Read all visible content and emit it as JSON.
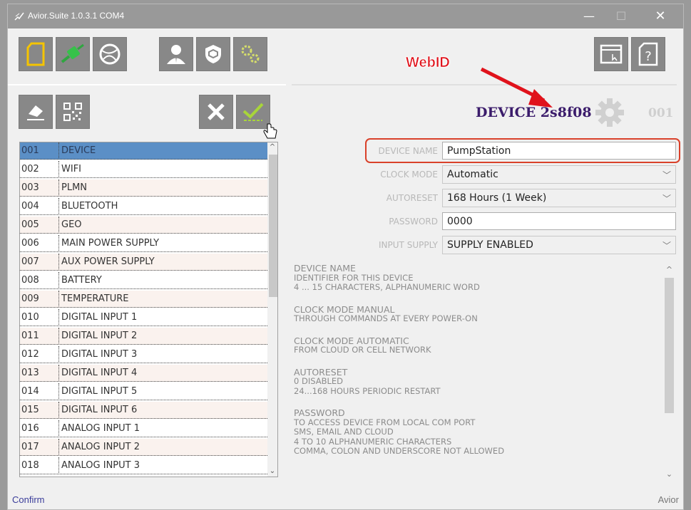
{
  "window": {
    "title": "Avior.Suite 1.0.3.1  COM4",
    "minimize": "—",
    "maximize": "☐",
    "close": "✕"
  },
  "toolbar": {
    "icons": [
      "new-document-icon",
      "usb-connection-icon",
      "cloud-globe-icon",
      "user-icon",
      "security-shield-icon",
      "settings-gears-icon"
    ],
    "right_icons": [
      "window-icon",
      "help-icon"
    ]
  },
  "annotation": {
    "webid_label": "WebID",
    "arrow_color": "#e0121b"
  },
  "editbar": {
    "icons": [
      "eraser-icon",
      "qr-code-icon",
      "cancel-x-icon",
      "confirm-check-icon"
    ]
  },
  "device": {
    "title": "DEVICE 2s8f08",
    "number": "001"
  },
  "list": {
    "rows": [
      {
        "num": "001",
        "name": "DEVICE"
      },
      {
        "num": "002",
        "name": "WIFI"
      },
      {
        "num": "003",
        "name": "PLMN"
      },
      {
        "num": "004",
        "name": "BLUETOOTH"
      },
      {
        "num": "005",
        "name": "GEO"
      },
      {
        "num": "006",
        "name": "MAIN POWER SUPPLY"
      },
      {
        "num": "007",
        "name": "AUX POWER SUPPLY"
      },
      {
        "num": "008",
        "name": "BATTERY"
      },
      {
        "num": "009",
        "name": "TEMPERATURE"
      },
      {
        "num": "010",
        "name": "DIGITAL INPUT 1"
      },
      {
        "num": "011",
        "name": "DIGITAL INPUT 2"
      },
      {
        "num": "012",
        "name": "DIGITAL INPUT 3"
      },
      {
        "num": "013",
        "name": "DIGITAL INPUT 4"
      },
      {
        "num": "014",
        "name": "DIGITAL INPUT 5"
      },
      {
        "num": "015",
        "name": "DIGITAL INPUT 6"
      },
      {
        "num": "016",
        "name": "ANALOG INPUT 1"
      },
      {
        "num": "017",
        "name": "ANALOG INPUT 2"
      },
      {
        "num": "018",
        "name": "ANALOG INPUT 3"
      }
    ],
    "selected_index": 0
  },
  "form": {
    "device_name": {
      "label": "DEVICE NAME",
      "value": "PumpStation"
    },
    "clock_mode": {
      "label": "CLOCK MODE",
      "value": "Automatic"
    },
    "autoreset": {
      "label": "AUTORESET",
      "value": "168 Hours (1 Week)"
    },
    "password": {
      "label": "PASSWORD",
      "value": "0000"
    },
    "input_supply": {
      "label": "INPUT SUPPLY",
      "value": "SUPPLY ENABLED"
    }
  },
  "help": {
    "blocks": [
      {
        "heading": "DEVICE NAME",
        "lines": [
          "IDENTIFIER FOR THIS DEVICE",
          "4 ... 15 CHARACTERS, ALPHANUMERIC WORD"
        ]
      },
      {
        "heading": "CLOCK MODE MANUAL",
        "lines": [
          "THROUGH COMMANDS AT EVERY POWER-ON"
        ]
      },
      {
        "heading": "CLOCK MODE AUTOMATIC",
        "lines": [
          "FROM CLOUD OR CELL NETWORK"
        ]
      },
      {
        "heading": "AUTORESET",
        "lines": [
          "0 DISABLED",
          "24...168 HOURS PERIODIC RESTART"
        ]
      },
      {
        "heading": "PASSWORD",
        "lines": [
          "TO ACCESS DEVICE FROM LOCAL COM PORT",
          "SMS, EMAIL AND CLOUD",
          "4 TO 10 ALPHANUMERIC CHARACTERS",
          "COMMA, COLON AND UNDERSCORE NOT ALLOWED"
        ]
      }
    ]
  },
  "status": {
    "left": "Confirm",
    "right": "Avior"
  },
  "colors": {
    "titlebar": "#999999",
    "toolbar_button": "#888888",
    "selected_row": "#5b8fc6",
    "device_title": "#3b1c6b",
    "webid": "#e0121b",
    "highlight": "#d9412a"
  }
}
